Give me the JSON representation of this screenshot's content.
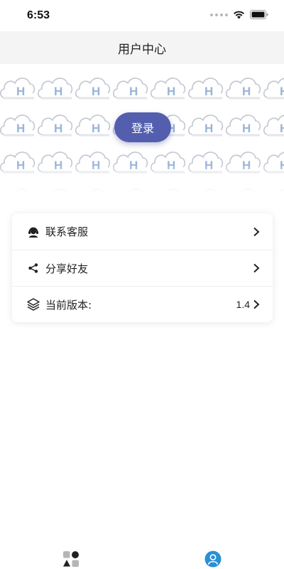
{
  "status_bar": {
    "time": "6:53"
  },
  "header": {
    "title": "用户中心"
  },
  "banner": {
    "login_label": "登录"
  },
  "menu": [
    {
      "icon": "headset-icon",
      "label": "联系客服",
      "value": ""
    },
    {
      "icon": "share-icon",
      "label": "分享好友",
      "value": ""
    },
    {
      "icon": "layers-icon",
      "label": "当前版本:",
      "value": "1.4"
    }
  ],
  "tab_bar": {
    "tabs": [
      {
        "icon": "shapes-icon",
        "active": false
      },
      {
        "icon": "user-icon",
        "active": true
      }
    ],
    "active_color": "#2b8fd6"
  },
  "colors": {
    "accent": "#535fae",
    "header_bg": "#f4f4f4"
  }
}
